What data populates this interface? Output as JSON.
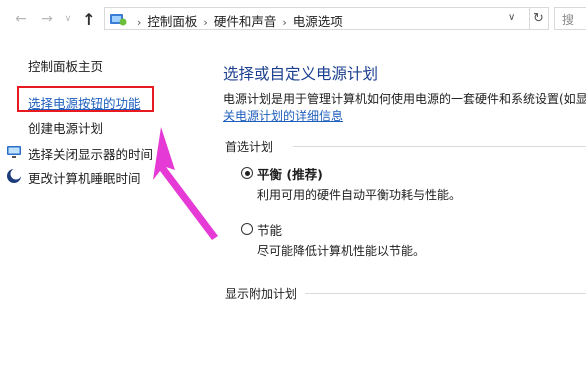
{
  "nav": {
    "back_icon": "back-arrow-icon",
    "forward_icon": "forward-arrow-icon",
    "up_icon": "up-arrow-icon"
  },
  "address": {
    "crumbs": [
      "控制面板",
      "硬件和声音",
      "电源选项"
    ],
    "search_placeholder": "搜"
  },
  "sidebar": {
    "home": "控制面板主页",
    "items": [
      {
        "label": "选择电源按钮的功能",
        "icon": null,
        "selected": true
      },
      {
        "label": "创建电源计划",
        "icon": null
      },
      {
        "label": "选择关闭显示器的时间",
        "icon": "monitor-icon"
      },
      {
        "label": "更改计算机睡眠时间",
        "icon": "moon-icon"
      }
    ]
  },
  "main": {
    "title": "选择或自定义电源计划",
    "description": "电源计划是用于管理计算机如何使用电源的一套硬件和系统设置(如显",
    "link": "关电源计划的详细信息",
    "preferred_group": "首选计划",
    "plans": [
      {
        "name": "平衡 (推荐)",
        "desc": "利用可用的硬件自动平衡功耗与性能。",
        "selected": true
      },
      {
        "name": "节能",
        "desc": "尽可能降低计算机性能以节能。",
        "selected": false
      }
    ],
    "extra_group": "显示附加计划"
  },
  "colors": {
    "highlight": "#e8191f",
    "arrow": "#e53ad6",
    "link": "#1e5fbd",
    "title": "#1b3f8f"
  }
}
